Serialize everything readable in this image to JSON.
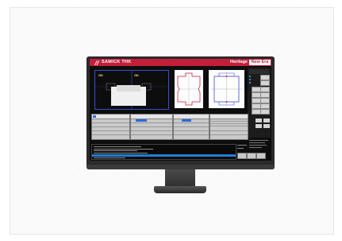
{
  "app": {
    "brand": "SAMICK THK",
    "tagline_primary": "Heritage",
    "tagline_highlight": "New Era"
  },
  "vision_view": {
    "roi_labels": [
      "OK",
      "OK"
    ]
  },
  "colors": {
    "brand_red": "#c41e3a",
    "roi_outline": "#3d4cd0",
    "ok_label": "#f2e46b",
    "selection_blue": "#2f6bd8",
    "log_highlight": "#1e7fd9"
  },
  "icons": [
    "logo-icon"
  ]
}
